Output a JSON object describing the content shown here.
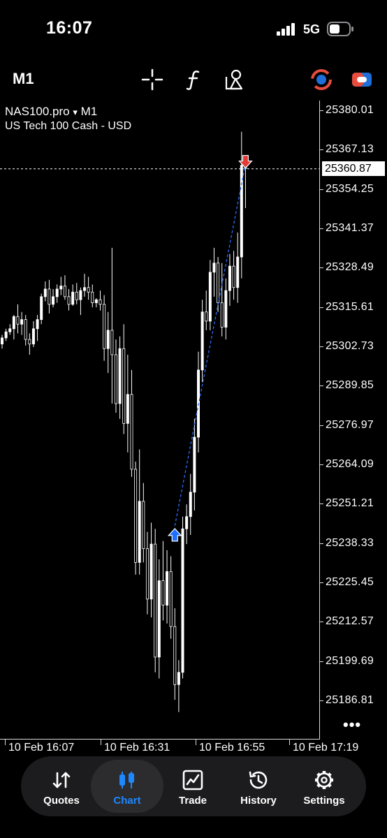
{
  "status": {
    "time": "16:07",
    "network": "5G"
  },
  "toolbar": {
    "timeframe": "M1",
    "tools": [
      "crosshair-icon",
      "function-icon",
      "objects-icon",
      "trading-app-icon",
      "toggle-app-icon"
    ]
  },
  "chart": {
    "symbol": "NAS100.pro",
    "symbol_arrow": "▾",
    "timeframe": "M1",
    "description": "US Tech 100 Cash - USD",
    "current_price": "25360.87",
    "more_label": "•••",
    "price_labels": [
      "25380.01",
      "25367.13",
      "25354.25",
      "25341.37",
      "25328.49",
      "25315.61",
      "25302.73",
      "25289.85",
      "25276.97",
      "25264.09",
      "25251.21",
      "25238.33",
      "25225.45",
      "25212.57",
      "25199.69",
      "25186.81"
    ],
    "time_labels": [
      "10 Feb 16:07",
      "10 Feb 16:31",
      "10 Feb 16:55",
      "10 Feb 17:19"
    ]
  },
  "chart_data": {
    "type": "candlestick",
    "symbol": "NAS100.pro",
    "timeframe": "M1",
    "x_labels": [
      "10 Feb 16:07",
      "10 Feb 16:31",
      "10 Feb 16:55",
      "10 Feb 17:19"
    ],
    "ylim": [
      25182,
      25384
    ],
    "current_price": 25360.87,
    "ohlc": [
      [
        25303.5,
        25306.5,
        25302.0,
        25305.5
      ],
      [
        25305.5,
        25308.5,
        25304.5,
        25307.5
      ],
      [
        25307.5,
        25310.0,
        25306.5,
        25308.5
      ],
      [
        25308.5,
        25313.0,
        25305.0,
        25312.5
      ],
      [
        25312.5,
        25316.5,
        25307.0,
        25310.0
      ],
      [
        25310.0,
        25314.0,
        25306.5,
        25311.5
      ],
      [
        25311.5,
        25313.0,
        25303.0,
        25305.0
      ],
      [
        25305.0,
        25307.0,
        25300.0,
        25303.5
      ],
      [
        25303.5,
        25311.0,
        25302.5,
        25308.5
      ],
      [
        25308.5,
        25313.0,
        25304.5,
        25311.5
      ],
      [
        25311.5,
        25320.0,
        25310.0,
        25319.0
      ],
      [
        25319.0,
        25324.0,
        25317.5,
        25321.5
      ],
      [
        25321.5,
        25324.5,
        25313.5,
        25316.5
      ],
      [
        25316.5,
        25321.5,
        25315.5,
        25319.0
      ],
      [
        25319.0,
        25323.0,
        25317.0,
        25321.5
      ],
      [
        25321.5,
        25325.5,
        25319.5,
        25322.5
      ],
      [
        25322.5,
        25326.0,
        25318.0,
        25319.0
      ],
      [
        25319.0,
        25321.5,
        25314.5,
        25316.5
      ],
      [
        25316.5,
        25323.0,
        25316.0,
        25320.5
      ],
      [
        25320.5,
        25323.5,
        25316.5,
        25318.0
      ],
      [
        25318.0,
        25322.0,
        25313.0,
        25321.0
      ],
      [
        25321.0,
        25326.5,
        25319.0,
        25322.0
      ],
      [
        25322.0,
        25325.5,
        25318.0,
        25320.5
      ],
      [
        25320.5,
        25323.0,
        25315.5,
        25317.0
      ],
      [
        25317.0,
        25318.5,
        25315.5,
        25318.0
      ],
      [
        25318.0,
        25321.0,
        25314.5,
        25316.5
      ],
      [
        25316.5,
        25319.5,
        25298.0,
        25302.0
      ],
      [
        25302.0,
        25314.0,
        25294.0,
        25308.0
      ],
      [
        25308.0,
        25335.0,
        25284.0,
        25300.0
      ],
      [
        25300.0,
        25305.0,
        25281.0,
        25284.0
      ],
      [
        25284.0,
        25306.0,
        25279.0,
        25302.0
      ],
      [
        25302.0,
        25310.0,
        25274.0,
        25277.5
      ],
      [
        25277.5,
        25300.0,
        25268.0,
        25287.0
      ],
      [
        25287.0,
        25295.0,
        25260.0,
        25262.5
      ],
      [
        25262.5,
        25265.0,
        25228.0,
        25232.0
      ],
      [
        25232.0,
        25269.0,
        25228.0,
        25252.0
      ],
      [
        25252.0,
        25258.0,
        25232.0,
        25236.5
      ],
      [
        25236.5,
        25242.0,
        25215.0,
        25220.0
      ],
      [
        25220.0,
        25245.0,
        25214.0,
        25238.0
      ],
      [
        25238.0,
        25243.0,
        25196.0,
        25201.0
      ],
      [
        25201.0,
        25233.0,
        25194.0,
        25226.0
      ],
      [
        25226.0,
        25239.0,
        25213.0,
        25218.0
      ],
      [
        25218.0,
        25236.0,
        25212.0,
        25229.0
      ],
      [
        25229.0,
        25234.0,
        25207.0,
        25211.0
      ],
      [
        25211.0,
        25217.0,
        25187.0,
        25192.0
      ],
      [
        25192.0,
        25200.0,
        25183.0,
        25196.0
      ],
      [
        25196.0,
        25247.0,
        25194.0,
        25243.0
      ],
      [
        25243.0,
        25251.0,
        25238.0,
        25247.0
      ],
      [
        25247.0,
        25261.0,
        25241.0,
        25255.0
      ],
      [
        25255.0,
        25279.0,
        25249.0,
        25273.0
      ],
      [
        25273.0,
        25301.0,
        25268.0,
        25295.0
      ],
      [
        25295.0,
        25318.0,
        25291.0,
        25314.0
      ],
      [
        25314.0,
        25321.0,
        25308.0,
        25311.0
      ],
      [
        25311.0,
        25331.0,
        25308.0,
        25327.0
      ],
      [
        25327.0,
        25335.0,
        25319.0,
        25330.0
      ],
      [
        25330.0,
        25332.0,
        25314.0,
        25317.0
      ],
      [
        25317.0,
        25330.0,
        25306.0,
        25309.0
      ],
      [
        25309.0,
        25325.0,
        25305.0,
        25321.0
      ],
      [
        25321.0,
        25333.0,
        25316.0,
        25329.0
      ],
      [
        25329.0,
        25334.0,
        25318.0,
        25322.0
      ],
      [
        25322.0,
        25340.0,
        25317.0,
        25332.0
      ],
      [
        25332.0,
        25373.0,
        25325.0,
        25362.0
      ],
      [
        25362.0,
        25365.0,
        25348.0,
        25360.9
      ]
    ],
    "trades": [
      {
        "side": "buy",
        "index": 44,
        "price": 25244.0
      },
      {
        "side": "sell",
        "index": 62,
        "price": 25362.5
      }
    ]
  }
}
